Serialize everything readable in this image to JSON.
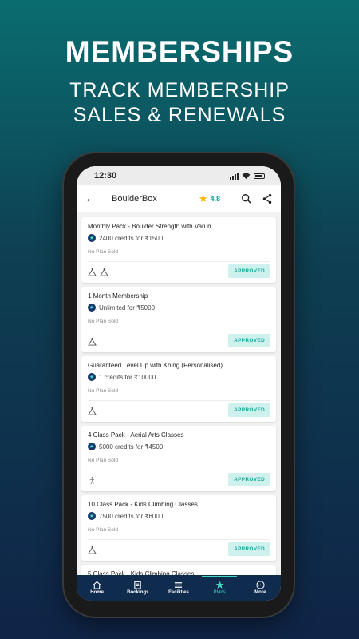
{
  "promo": {
    "title": "MEMBERSHIPS",
    "subtitle_line1": "TRACK MEMBERSHIP",
    "subtitle_line2": "SALES & RENEWALS"
  },
  "status_bar": {
    "time": "12:30"
  },
  "app_bar": {
    "back_icon": "back-arrow-icon",
    "title": "BoulderBox",
    "rating": "4.8",
    "search_icon": "search-icon",
    "share_icon": "share-icon"
  },
  "colors": {
    "accent": "#3fd6c2",
    "nav_bg": "#0f2b4d",
    "approved_bg": "#cff1ee",
    "approved_text": "#1aa79a",
    "rating_star": "#f4b400"
  },
  "cards": [
    {
      "title": "Monthly Pack - Boulder Strength with Varun",
      "credits": "2400 credits for ₹1500",
      "sold": "No Plan Sold",
      "facility_icons": 2,
      "status": "APPROVED"
    },
    {
      "title": "1 Month Membership",
      "credits": "Unlimited for ₹5000",
      "sold": "No Plan Sold",
      "facility_icons": 1,
      "status": "APPROVED"
    },
    {
      "title": "Guaranteed Level Up with Khing (Personalised)",
      "credits": "1 credits for ₹10000",
      "sold": "No Plan Sold",
      "facility_icons": 1,
      "status": "APPROVED"
    },
    {
      "title": "4 Class Pack - Aerial Arts Classes",
      "credits": "5000 credits for ₹4500",
      "sold": "No Plan Sold",
      "facility_icons": 1,
      "status": "APPROVED"
    },
    {
      "title": "10 Class Pack - Kids Climbing Classes",
      "credits": "7500 credits for ₹6000",
      "sold": "No Plan Sold",
      "facility_icons": 1,
      "status": "APPROVED"
    },
    {
      "title": "5 Class Pack - Kids Climbing Classes"
    }
  ],
  "bottom_nav": [
    {
      "label": "Home",
      "icon": "home-icon"
    },
    {
      "label": "Bookings",
      "icon": "bookings-icon"
    },
    {
      "label": "Facilities",
      "icon": "menu-icon"
    },
    {
      "label": "Plans",
      "icon": "star-icon",
      "active": true
    },
    {
      "label": "More",
      "icon": "more-icon"
    }
  ]
}
